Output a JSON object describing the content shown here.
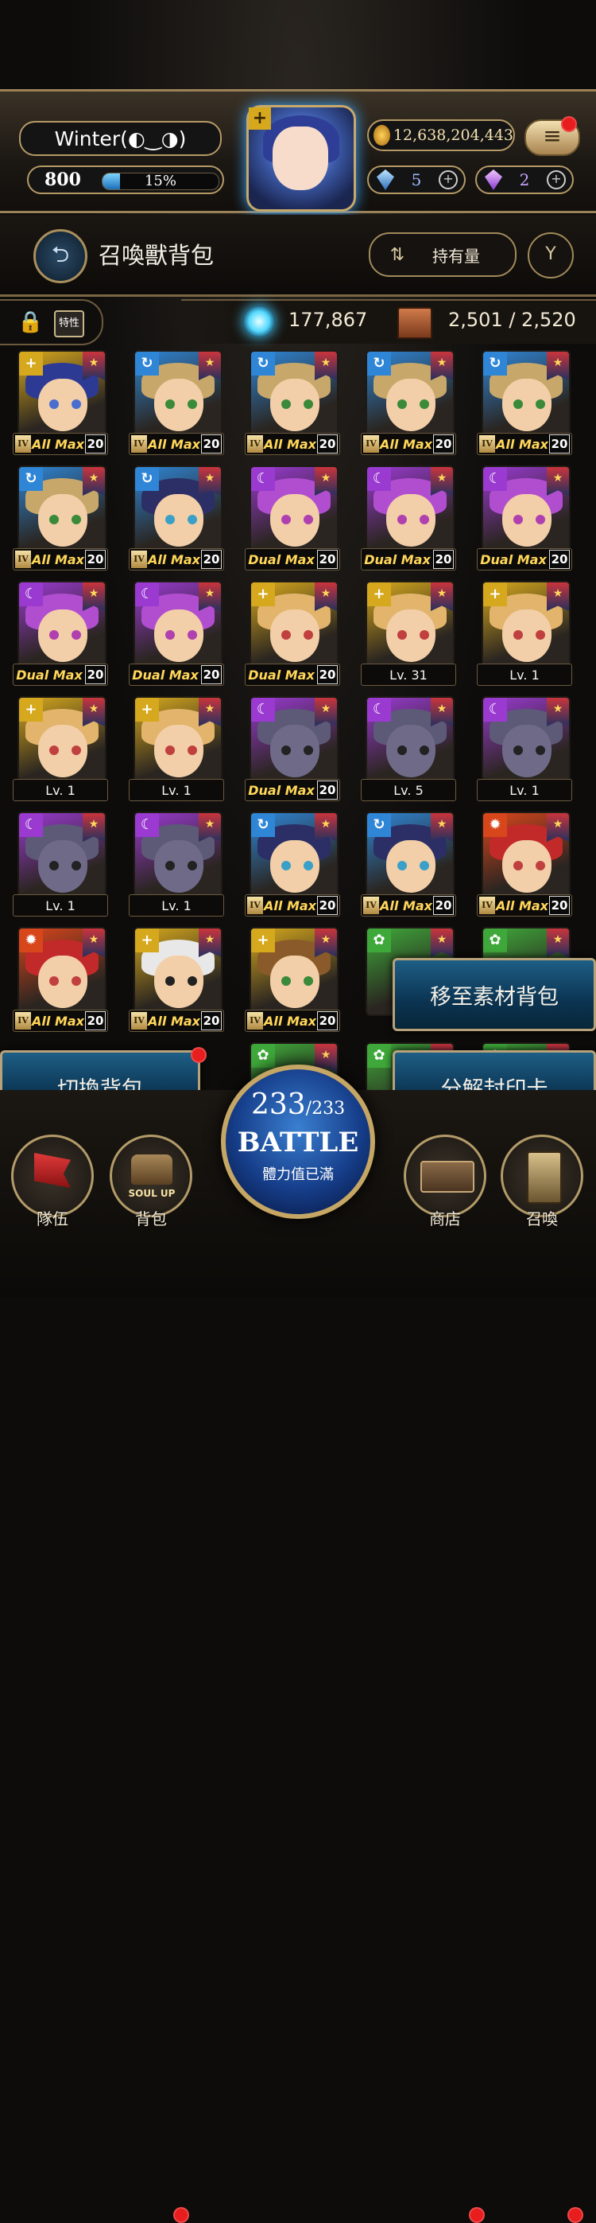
{
  "player": {
    "name": "Winter(◐‿◑)",
    "level": "800",
    "exp_percent": "15%",
    "exp_fraction": 0.15
  },
  "currency": {
    "gold": "12,638,204,443",
    "blue_gems": "5",
    "purple_gems": "2"
  },
  "header": {
    "title": "召喚獸背包",
    "sort_label": "持有量"
  },
  "stats": {
    "trait_label": "特性",
    "orb_count": "177,867",
    "capacity": "2,501 / 2,520"
  },
  "cards": [
    {
      "elem": "light",
      "hair": "#2d3a94",
      "eye": "#4a6dd0",
      "tier": "IV",
      "status": "All Max",
      "skill": "20"
    },
    {
      "elem": "water",
      "hair": "#c8a86a",
      "eye": "#3a8a3a",
      "tier": "IV",
      "status": "All Max",
      "skill": "20"
    },
    {
      "elem": "water",
      "hair": "#c8a86a",
      "eye": "#3a8a3a",
      "tier": "IV",
      "status": "All Max",
      "skill": "20"
    },
    {
      "elem": "water",
      "hair": "#c8a86a",
      "eye": "#3a8a3a",
      "tier": "IV",
      "status": "All Max",
      "skill": "20"
    },
    {
      "elem": "water",
      "hair": "#c8a86a",
      "eye": "#3a8a3a",
      "tier": "IV",
      "status": "All Max",
      "skill": "20"
    },
    {
      "elem": "water",
      "hair": "#c8a86a",
      "eye": "#3a8a3a",
      "tier": "IV",
      "status": "All Max",
      "skill": "20"
    },
    {
      "elem": "water",
      "hair": "#2b2f66",
      "eye": "#3aa0c8",
      "tier": "IV",
      "status": "All Max",
      "skill": "20"
    },
    {
      "elem": "dark",
      "hair": "#b14ed0",
      "eye": "#b040b0",
      "tier": "",
      "status": "Dual Max",
      "skill": "20"
    },
    {
      "elem": "dark",
      "hair": "#b14ed0",
      "eye": "#b040b0",
      "tier": "",
      "status": "Dual Max",
      "skill": "20"
    },
    {
      "elem": "dark",
      "hair": "#b14ed0",
      "eye": "#b040b0",
      "tier": "",
      "status": "Dual Max",
      "skill": "20"
    },
    {
      "elem": "dark",
      "hair": "#b14ed0",
      "eye": "#b040b0",
      "tier": "",
      "status": "Dual Max",
      "skill": "20"
    },
    {
      "elem": "dark",
      "hair": "#b14ed0",
      "eye": "#b040b0",
      "tier": "",
      "status": "Dual Max",
      "skill": "20"
    },
    {
      "elem": "light",
      "hair": "#e2b46c",
      "eye": "#c04040",
      "tier": "",
      "status": "Dual Max",
      "skill": "20"
    },
    {
      "elem": "light",
      "hair": "#e2b46c",
      "eye": "#c04040",
      "tier": "",
      "status": "Lv. 31",
      "skill": ""
    },
    {
      "elem": "light",
      "hair": "#e2b46c",
      "eye": "#c04040",
      "tier": "",
      "status": "Lv. 1",
      "skill": ""
    },
    {
      "elem": "light",
      "hair": "#e2b46c",
      "eye": "#c04040",
      "tier": "",
      "status": "Lv. 1",
      "skill": ""
    },
    {
      "elem": "light",
      "hair": "#e2b46c",
      "eye": "#c04040",
      "tier": "",
      "status": "Lv. 1",
      "skill": ""
    },
    {
      "elem": "dark",
      "hair": "#5d5a78",
      "eye": "#222222",
      "tier": "",
      "status": "Dual Max",
      "skill": "20"
    },
    {
      "elem": "dark",
      "hair": "#5d5a78",
      "eye": "#222222",
      "tier": "",
      "status": "Lv. 5",
      "skill": ""
    },
    {
      "elem": "dark",
      "hair": "#5d5a78",
      "eye": "#222222",
      "tier": "",
      "status": "Lv. 1",
      "skill": ""
    },
    {
      "elem": "dark",
      "hair": "#5d5a78",
      "eye": "#222222",
      "tier": "",
      "status": "Lv. 1",
      "skill": ""
    },
    {
      "elem": "dark",
      "hair": "#5d5a78",
      "eye": "#222222",
      "tier": "",
      "status": "Lv. 1",
      "skill": ""
    },
    {
      "elem": "water",
      "hair": "#2b2f66",
      "eye": "#3aa0c8",
      "tier": "IV",
      "status": "All Max",
      "skill": "20"
    },
    {
      "elem": "water",
      "hair": "#2b2f66",
      "eye": "#3aa0c8",
      "tier": "IV",
      "status": "All Max",
      "skill": "20"
    },
    {
      "elem": "fire",
      "hair": "#c22a2a",
      "eye": "#c04040",
      "tier": "IV",
      "status": "All Max",
      "skill": "20"
    },
    {
      "elem": "fire",
      "hair": "#c22a2a",
      "eye": "#c04040",
      "tier": "IV",
      "status": "All Max",
      "skill": "20"
    },
    {
      "elem": "light",
      "hair": "#e8e8e8",
      "eye": "#222222",
      "tier": "IV",
      "status": "All Max",
      "skill": "20"
    },
    {
      "elem": "light",
      "hair": "#8a5a2a",
      "eye": "#3a8a3a",
      "tier": "IV",
      "status": "All Max",
      "skill": "20"
    }
  ],
  "partial_cards": [
    {
      "elem": "wood"
    },
    {
      "elem": "wood"
    },
    {
      "elem": "wood"
    },
    {
      "elem": "wood"
    },
    {
      "elem": "wood"
    }
  ],
  "actions": {
    "move_to_material": "移至素材背包",
    "switch_bag": "切換背包",
    "decompose_seal": "分解封印卡"
  },
  "battle": {
    "current": "233",
    "max": "/233",
    "label": "BATTLE",
    "stamina_text": "體力值已滿"
  },
  "nav": {
    "team": "隊伍",
    "bag": "背包",
    "soul_up": "SOUL UP",
    "shop": "商店",
    "summon": "召喚"
  },
  "colors": {
    "fire": "#d8461c",
    "water": "#2f86d6",
    "wood": "#3fa83a",
    "light": "#d6a81e",
    "dark": "#9a3ad0"
  }
}
